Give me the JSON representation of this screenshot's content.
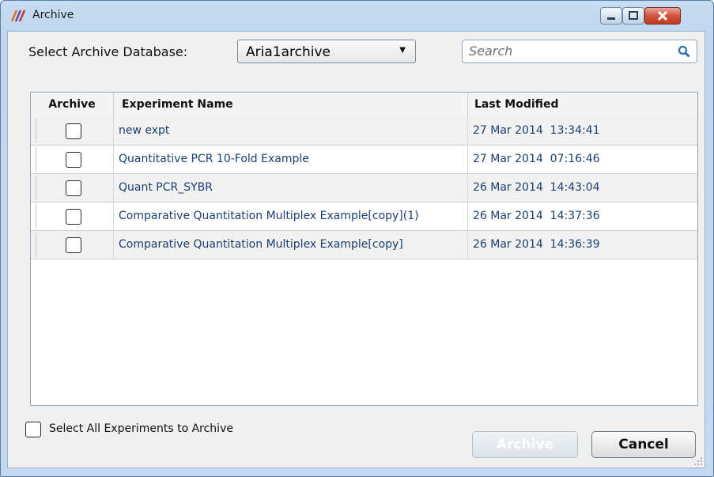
{
  "window": {
    "title": "Archive"
  },
  "select_db": {
    "label": "Select Archive Database:",
    "selected": "Aria1archive"
  },
  "search": {
    "placeholder": "Search"
  },
  "table": {
    "columns": [
      "Archive",
      "Experiment Name",
      "Last Modified"
    ],
    "rows": [
      {
        "checked": false,
        "name": "new expt",
        "modified": "27 Mar 2014  13:34:41"
      },
      {
        "checked": false,
        "name": "Quantitative PCR 10-Fold Example",
        "modified": "27 Mar 2014  07:16:46"
      },
      {
        "checked": false,
        "name": "Quant PCR_SYBR",
        "modified": "26 Mar 2014  14:43:04"
      },
      {
        "checked": false,
        "name": "Comparative Quantitation Multiplex Example[copy](1)",
        "modified": "26 Mar 2014  14:37:36"
      },
      {
        "checked": false,
        "name": "Comparative Quantitation Multiplex Example[copy]",
        "modified": "26 Mar 2014  14:36:39"
      }
    ]
  },
  "select_all": {
    "label": "Select All Experiments to Archive",
    "checked": false
  },
  "buttons": {
    "archive": "Archive",
    "cancel": "Cancel"
  },
  "colors": {
    "link_text": "#1b3f70",
    "title_bar": "#c3d9ef",
    "close_button": "#c03a22"
  }
}
